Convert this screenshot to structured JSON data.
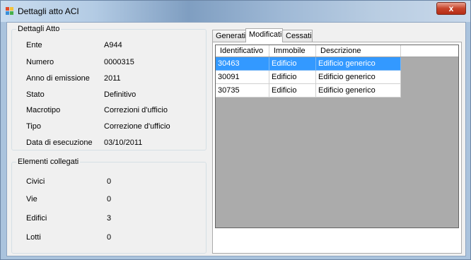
{
  "window": {
    "title": "Dettagli atto ACI",
    "close_label": "x"
  },
  "dettagli": {
    "group_title": "Dettagli Atto",
    "rows": [
      {
        "label": "Ente",
        "value": "A944"
      },
      {
        "label": "Numero",
        "value": "0000315"
      },
      {
        "label": "Anno di emissione",
        "value": "2011"
      },
      {
        "label": "Stato",
        "value": "Definitivo"
      },
      {
        "label": "Macrotipo",
        "value": "Correzioni d'ufficio"
      },
      {
        "label": "Tipo",
        "value": "Correzione d'ufficio"
      },
      {
        "label": "Data di esecuzione",
        "value": "03/10/2011"
      }
    ]
  },
  "collegati": {
    "group_title": "Elementi collegati",
    "rows": [
      {
        "label": "Civici",
        "value": "0"
      },
      {
        "label": "Vie",
        "value": "0"
      },
      {
        "label": "Edifici",
        "value": "3"
      },
      {
        "label": "Lotti",
        "value": "0"
      }
    ]
  },
  "tabs": [
    {
      "label": "Generati",
      "active": false
    },
    {
      "label": "Modificati",
      "active": true
    },
    {
      "label": "Cessati",
      "active": false
    }
  ],
  "grid": {
    "columns": [
      "Identificativo",
      "Immobile",
      "Descrizione"
    ],
    "rows": [
      {
        "cells": [
          "30463",
          "Edificio",
          "Edificio generico"
        ],
        "selected": true
      },
      {
        "cells": [
          "30091",
          "Edificio",
          "Edificio generico"
        ],
        "selected": false
      },
      {
        "cells": [
          "30735",
          "Edificio",
          "Edificio generico"
        ],
        "selected": false
      }
    ]
  },
  "colors": {
    "selection": "#3399ff",
    "grid_background": "#ababab"
  }
}
